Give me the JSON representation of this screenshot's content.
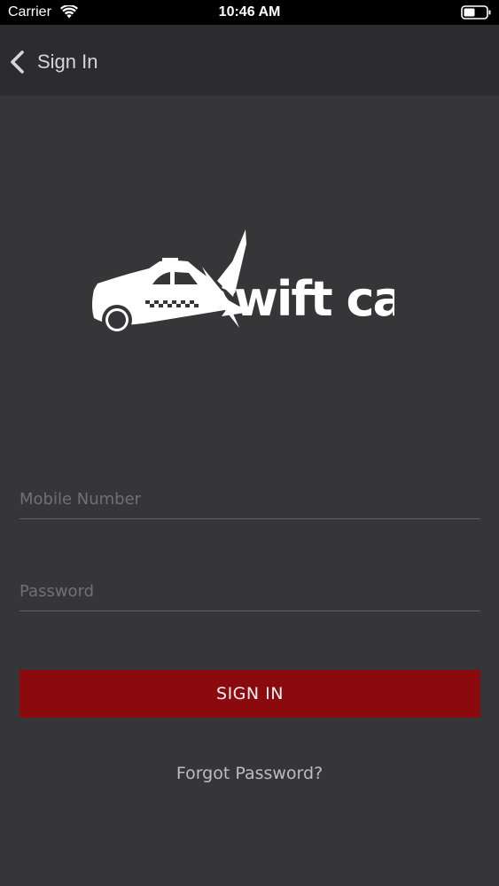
{
  "status_bar": {
    "carrier": "Carrier",
    "time": "10:46 AM",
    "icons": [
      "wifi-icon",
      "battery-icon"
    ]
  },
  "nav": {
    "back_icon": "chevron-left-icon",
    "title": "Sign In"
  },
  "logo": {
    "text": "Swift cab",
    "icon": "taxi-car-icon"
  },
  "form": {
    "mobile_placeholder": "Mobile Number",
    "mobile_value": "",
    "password_placeholder": "Password",
    "password_value": "",
    "signin_label": "SIGN IN",
    "forgot_label": "Forgot Password?"
  },
  "colors": {
    "background": "#363538",
    "nav_background": "#2c2b2d",
    "status_bar": "#000000",
    "signin_button": "#8b0a0d"
  }
}
